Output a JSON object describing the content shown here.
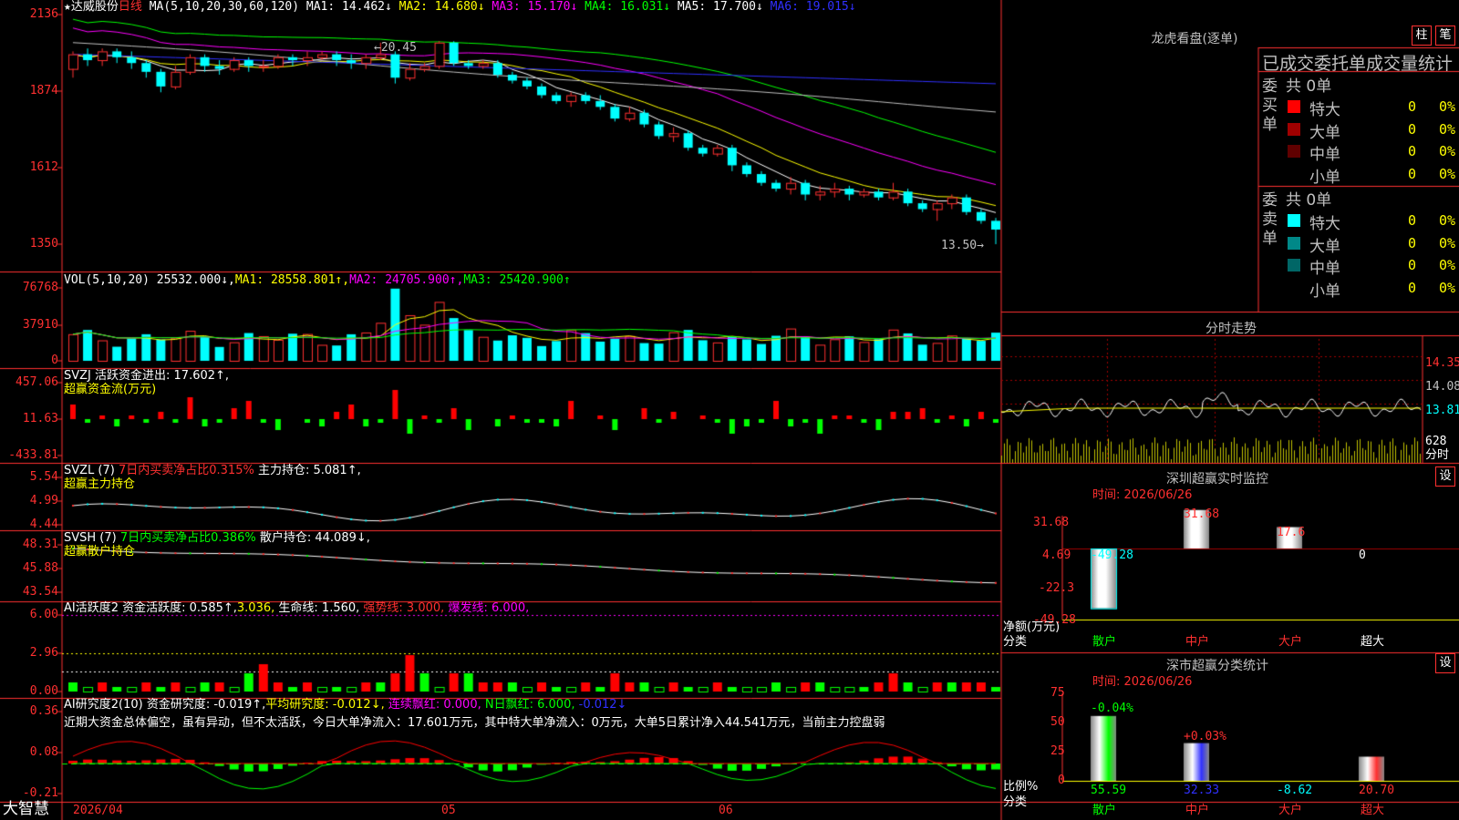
{
  "header": {
    "star": "★",
    "stock_name": "达威股份",
    "period": "日线",
    "ma_params": "MA(5,10,20,30,60,120)",
    "ma1": "MA1: 14.462↓",
    "ma2": "MA2: 14.680↓",
    "ma3": "MA3: 15.170↓",
    "ma4": "MA4: 16.031↓",
    "ma5": "MA5: 17.700↓",
    "ma6": "MA6: 19.015↓",
    "high_mark": "20.45",
    "low_mark": "13.50→"
  },
  "price_axis": [
    "2136",
    "1874",
    "1612",
    "1350"
  ],
  "vol": {
    "label": "VOL(5,10,20)",
    "value": "25532.000↓,",
    "ma1": "MA1: 28558.801↑,",
    "ma2": "MA2: 24705.900↑,",
    "ma3": "MA3: 25420.900↑",
    "axis": [
      "76768",
      "37910",
      "0"
    ]
  },
  "svzj": {
    "label": "SVZJ  活跃资金进出: 17.602↑,",
    "sub": "超赢资金流(万元)",
    "axis": [
      "457.06",
      "11.63",
      "-433.81"
    ]
  },
  "svzl": {
    "label1": "SVZL (7)",
    "label2": "7日内买卖净占比0.315%",
    "label3": "主力持仓: 5.081↑,",
    "sub": "超赢主力持仓",
    "axis": [
      "5.54",
      "4.99",
      "4.44"
    ]
  },
  "svsh": {
    "label1": "SVSH (7)",
    "label2": "7日内买卖净占比0.386%",
    "label3": "散户持仓: 44.089↓,",
    "sub": "超赢散户持仓",
    "axis": [
      "48.31",
      "45.88",
      "43.54"
    ]
  },
  "ai1": {
    "label1": "AI活跃度2",
    "label2": "资金活跃度: 0.585↑,",
    "label3": "3.036,",
    "label4": "生命线: 1.560,",
    "label5": "强势线: 3.000,",
    "label6": "爆发线: 6.000,",
    "axis": [
      "6.00",
      "2.96",
      "0.00"
    ]
  },
  "ai2": {
    "label1": "AI研究度2(10)",
    "label2": "资金研究度: -0.019↑,",
    "label3": "平均研究度: -0.012↓,",
    "label4": "连续飘红: 0.000,",
    "label5": "N日飘红: 6.000,",
    "label6": "-0.012↓",
    "comment": "近期大资金总体偏空，虽有异动，但不太活跃，今日大单净流入：17.601万元，其中特大单净流入：0万元，大单5日累计净入44.541万元，当前主力控盘弱",
    "axis": [
      "0.36",
      "0.08",
      "-0.21"
    ]
  },
  "date_axis": {
    "d1": "2026/04",
    "d2": "05",
    "d3": "06"
  },
  "brand": "大智慧",
  "lhp": {
    "title": "龙虎看盘(逐单)",
    "btn1": "柱",
    "btn2": "笔",
    "tabs": "已成交委托单成交量统计",
    "buy_side": "委买单",
    "sell_side": "委卖单",
    "buy_total": "共 0单",
    "sell_total": "共 0单",
    "rows_buy": [
      {
        "name": "特大",
        "count": "0",
        "pct": "0%",
        "color": "#ff0000"
      },
      {
        "name": "大单",
        "count": "0",
        "pct": "0%",
        "color": "#a00000"
      },
      {
        "name": "中单",
        "count": "0",
        "pct": "0%",
        "color": "#600000"
      },
      {
        "name": "小单",
        "count": "0",
        "pct": "0%",
        "color": "#000000"
      }
    ],
    "rows_sell": [
      {
        "name": "特大",
        "count": "0",
        "pct": "0%",
        "color": "#00ffff"
      },
      {
        "name": "大单",
        "count": "0",
        "pct": "0%",
        "color": "#008888"
      },
      {
        "name": "中单",
        "count": "0",
        "pct": "0%",
        "color": "#006666"
      },
      {
        "name": "小单",
        "count": "0",
        "pct": "0%",
        "color": "#000000"
      }
    ]
  },
  "intraday": {
    "title": "分时走势",
    "axis": [
      "14.35",
      "14.08",
      "13.81",
      "628",
      "分时"
    ]
  },
  "sz_monitor": {
    "title": "深圳超赢实时监控",
    "btn": "设",
    "time": "时间: 2026/06/26",
    "axis": [
      "31.68",
      "4.69",
      "-22.3",
      "-49.28"
    ],
    "ylabel": "净额(万元)",
    "xlabel": "分类",
    "values": [
      {
        "cat": "散户",
        "value": -49.28,
        "label": "-49.28"
      },
      {
        "cat": "中户",
        "value": 31.68,
        "label": "31.68"
      },
      {
        "cat": "大户",
        "value": 17.6,
        "label": "17.6"
      },
      {
        "cat": "超大",
        "value": 0,
        "label": "0"
      }
    ]
  },
  "sz_stats": {
    "title": "深市超赢分类统计",
    "btn": "设",
    "time": "时间: 2026/06/26",
    "axis": [
      "75",
      "50",
      "25",
      "0"
    ],
    "ylabel": "比例%",
    "xlabel": "分类",
    "values": [
      {
        "cat": "散户",
        "value": 55.59,
        "label": "55.59",
        "change": "-0.04%"
      },
      {
        "cat": "中户",
        "value": 32.33,
        "label": "32.33",
        "change": "+0.03%"
      },
      {
        "cat": "大户",
        "value": -8.62,
        "label": "-8.62",
        "change": ""
      },
      {
        "cat": "超大",
        "value": 20.7,
        "label": "20.70",
        "change": ""
      }
    ]
  },
  "chart_data": {
    "type": "candlestick",
    "candles": [
      [
        19.5,
        20.0,
        19.2,
        20.1
      ],
      [
        20.0,
        19.8,
        19.6,
        20.2
      ],
      [
        19.8,
        20.1,
        19.6,
        20.2
      ],
      [
        20.1,
        19.9,
        19.7,
        20.2
      ],
      [
        19.9,
        19.7,
        19.5,
        20.1
      ],
      [
        19.7,
        19.4,
        19.2,
        19.8
      ],
      [
        19.4,
        18.9,
        18.7,
        19.5
      ],
      [
        18.9,
        19.4,
        18.8,
        19.6
      ],
      [
        19.4,
        19.9,
        19.3,
        20.0
      ],
      [
        19.9,
        19.6,
        19.4,
        20.0
      ],
      [
        19.6,
        19.5,
        19.3,
        19.8
      ],
      [
        19.5,
        19.8,
        19.4,
        19.9
      ],
      [
        19.8,
        19.6,
        19.4,
        19.9
      ],
      [
        19.6,
        19.6,
        19.4,
        19.8
      ],
      [
        19.6,
        19.9,
        19.5,
        20.0
      ],
      [
        19.9,
        19.8,
        19.6,
        20.0
      ],
      [
        19.8,
        19.9,
        19.6,
        20.1
      ],
      [
        19.9,
        20.0,
        19.8,
        20.1
      ],
      [
        20.0,
        19.8,
        19.6,
        20.1
      ],
      [
        19.8,
        19.7,
        19.5,
        20.0
      ],
      [
        19.7,
        19.9,
        19.5,
        20.0
      ],
      [
        19.9,
        20.0,
        19.8,
        20.4
      ],
      [
        20.0,
        19.2,
        19.0,
        20.1
      ],
      [
        19.2,
        19.5,
        19.1,
        19.7
      ],
      [
        19.5,
        19.6,
        19.4,
        19.7
      ],
      [
        19.6,
        20.4,
        19.5,
        20.45
      ],
      [
        20.4,
        19.7,
        19.6,
        20.45
      ],
      [
        19.7,
        19.6,
        19.5,
        19.8
      ],
      [
        19.6,
        19.7,
        19.5,
        19.8
      ],
      [
        19.7,
        19.3,
        19.2,
        19.8
      ],
      [
        19.3,
        19.1,
        19.0,
        19.4
      ],
      [
        19.1,
        18.9,
        18.8,
        19.2
      ],
      [
        18.9,
        18.6,
        18.5,
        19.0
      ],
      [
        18.6,
        18.4,
        18.3,
        18.7
      ],
      [
        18.4,
        18.6,
        18.2,
        18.7
      ],
      [
        18.6,
        18.4,
        18.3,
        18.7
      ],
      [
        18.4,
        18.2,
        18.1,
        18.6
      ],
      [
        18.2,
        17.8,
        17.7,
        18.3
      ],
      [
        17.8,
        18.0,
        17.7,
        18.2
      ],
      [
        18.0,
        17.6,
        17.5,
        18.1
      ],
      [
        17.6,
        17.2,
        17.1,
        17.7
      ],
      [
        17.2,
        17.3,
        17.0,
        17.5
      ],
      [
        17.3,
        16.8,
        16.7,
        17.4
      ],
      [
        16.8,
        16.6,
        16.5,
        16.9
      ],
      [
        16.6,
        16.8,
        16.5,
        16.9
      ],
      [
        16.8,
        16.2,
        16.0,
        16.9
      ],
      [
        16.2,
        15.9,
        15.8,
        16.3
      ],
      [
        15.9,
        15.6,
        15.5,
        16.0
      ],
      [
        15.6,
        15.4,
        15.3,
        15.7
      ],
      [
        15.4,
        15.6,
        15.2,
        15.8
      ],
      [
        15.6,
        15.2,
        15.0,
        15.7
      ],
      [
        15.2,
        15.3,
        15.0,
        15.5
      ],
      [
        15.3,
        15.4,
        15.1,
        15.6
      ],
      [
        15.4,
        15.2,
        15.0,
        15.5
      ],
      [
        15.2,
        15.3,
        15.1,
        15.4
      ],
      [
        15.3,
        15.1,
        15.0,
        15.4
      ],
      [
        15.1,
        15.3,
        15.0,
        15.6
      ],
      [
        15.3,
        14.9,
        14.8,
        15.4
      ],
      [
        14.9,
        14.7,
        14.6,
        15.0
      ],
      [
        14.7,
        14.9,
        14.3,
        15.0
      ],
      [
        14.9,
        15.1,
        14.7,
        15.2
      ],
      [
        15.1,
        14.6,
        14.5,
        15.2
      ],
      [
        14.6,
        14.3,
        14.2,
        14.7
      ],
      [
        14.3,
        14.0,
        13.5,
        14.4
      ]
    ]
  }
}
